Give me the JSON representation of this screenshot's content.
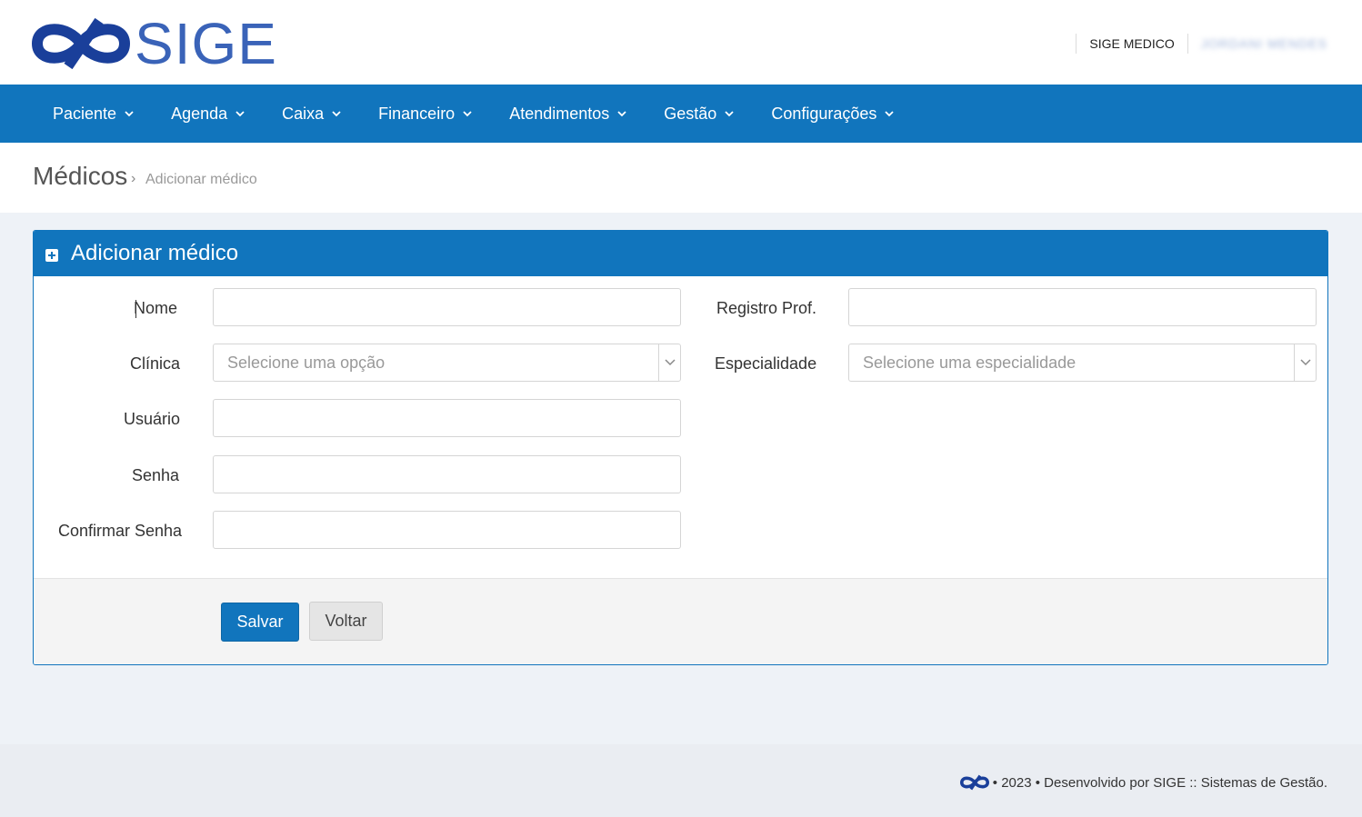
{
  "header": {
    "logo_text": "SIGE",
    "user_label": "SIGE MEDICO",
    "user_name": "JORDANI MENDES"
  },
  "nav": {
    "items": [
      {
        "label": "Paciente"
      },
      {
        "label": "Agenda"
      },
      {
        "label": "Caixa"
      },
      {
        "label": "Financeiro"
      },
      {
        "label": "Atendimentos"
      },
      {
        "label": "Gestão"
      },
      {
        "label": "Configurações"
      }
    ]
  },
  "breadcrumb": {
    "title": "Médicos",
    "separator": "›",
    "current": "Adicionar médico"
  },
  "panel": {
    "title": "Adicionar médico"
  },
  "form": {
    "nome_label": "Nome",
    "nome_value": "",
    "registro_label": "Registro Prof.",
    "registro_value": "",
    "clinica_label": "Clínica",
    "clinica_placeholder": "Selecione uma opção",
    "especialidade_label": "Especialidade",
    "especialidade_placeholder": "Selecione uma especialidade",
    "usuario_label": "Usuário",
    "usuario_value": "",
    "senha_label": "Senha",
    "senha_value": "",
    "confirmar_label": "Confirmar Senha",
    "confirmar_value": ""
  },
  "actions": {
    "save_label": "Salvar",
    "back_label": "Voltar"
  },
  "footer": {
    "text": "• 2023 • Desenvolvido por SIGE :: Sistemas de Gestão."
  },
  "colors": {
    "primary": "#1175bd",
    "logo": "#3a63b8"
  }
}
